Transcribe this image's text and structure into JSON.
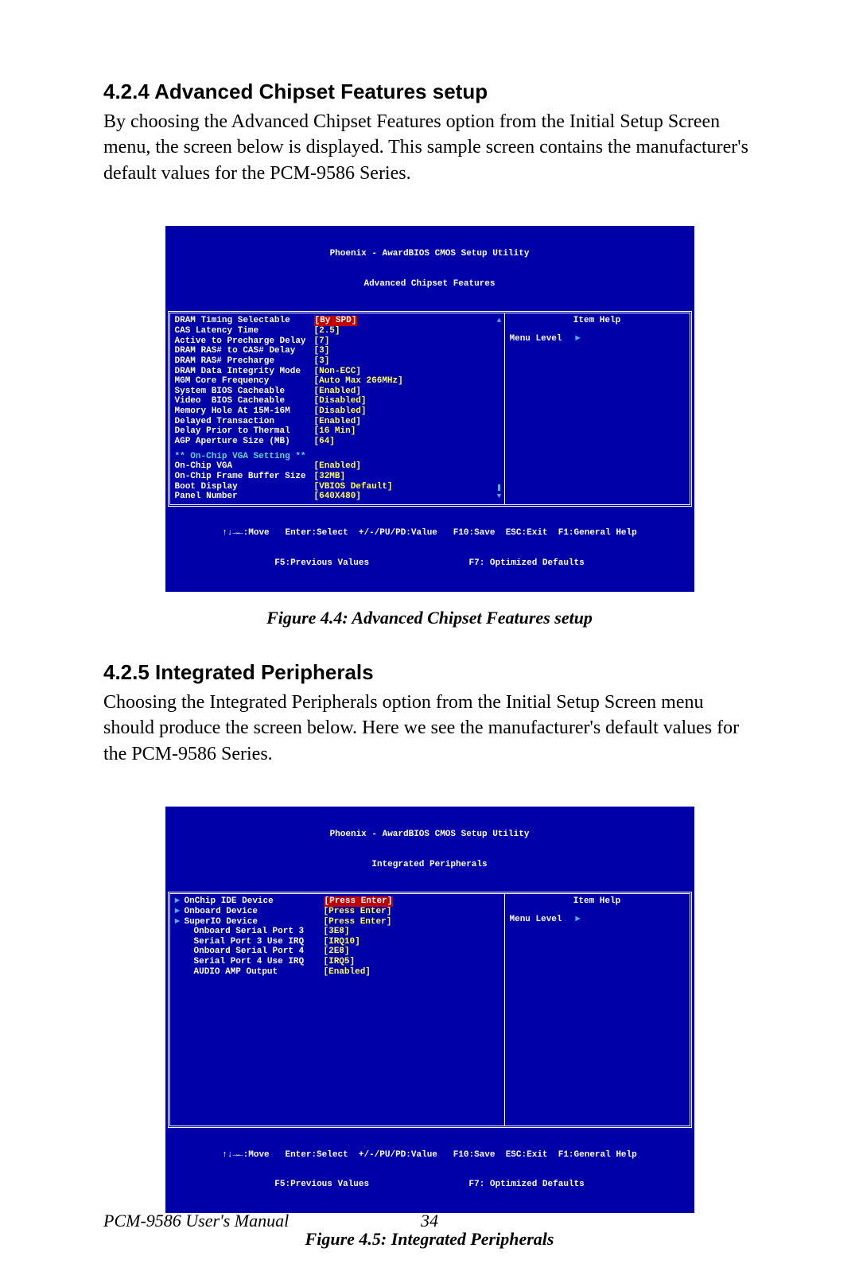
{
  "section1": {
    "heading": "4.2.4 Advanced Chipset Features setup",
    "body": "By choosing the Advanced Chipset Features option from the Initial Setup Screen menu, the screen below is displayed. This sample screen contains the manufacturer's default values for the PCM-9586 Series."
  },
  "figure1": {
    "bios_title1": "Phoenix - AwardBIOS CMOS Setup Utility",
    "bios_title2": "Advanced Chipset Features",
    "help_title": "Item Help",
    "menu_level": "Menu Level",
    "rows": [
      {
        "label": "DRAM Timing Selectable",
        "value": "[By SPD]",
        "selected": true
      },
      {
        "label": "CAS Latency Time",
        "value": "[2.5]"
      },
      {
        "label": "Active to Precharge Delay",
        "value": "[7]"
      },
      {
        "label": "DRAM RAS# to CAS# Delay",
        "value": "[3]"
      },
      {
        "label": "DRAM RAS# Precharge",
        "value": "[3]"
      },
      {
        "label": "DRAM Data Integrity Mode",
        "value": "[Non-ECC]"
      },
      {
        "label": "MGM Core Frequency",
        "value": "[Auto Max 266MHz]"
      },
      {
        "label": "System BIOS Cacheable",
        "value": "[Enabled]"
      },
      {
        "label": "Video  BIOS Cacheable",
        "value": "[Disabled]"
      },
      {
        "label": "Memory Hole At 15M-16M",
        "value": "[Disabled]"
      },
      {
        "label": "Delayed Transaction",
        "value": "[Enabled]"
      },
      {
        "label": "Delay Prior to Thermal",
        "value": "[16 Min]"
      },
      {
        "label": "AGP Aperture Size (MB)",
        "value": "[64]"
      }
    ],
    "vga_section": "** On-Chip VGA Setting **",
    "vga_rows": [
      {
        "label": "On-Chip VGA",
        "value": "[Enabled]"
      },
      {
        "label": "On-Chip Frame Buffer Size",
        "value": "[32MB]"
      },
      {
        "label": "Boot Display",
        "value": "[VBIOS Default]"
      },
      {
        "label": "Panel Number",
        "value": "[640X480]"
      }
    ],
    "footer1": "↑↓→←:Move   Enter:Select  +/-/PU/PD:Value   F10:Save  ESC:Exit  F1:General Help",
    "footer2": "F5:Previous Values                   F7: Optimized Defaults",
    "caption": "Figure 4.4: Advanced Chipset Features setup"
  },
  "section2": {
    "heading": "4.2.5 Integrated Peripherals",
    "body": "Choosing the Integrated Peripherals option from the Initial Setup Screen menu should produce the screen below.  Here we see the manufacturer's default values for the PCM-9586 Series."
  },
  "figure2": {
    "bios_title1": "Phoenix - AwardBIOS CMOS Setup Utility",
    "bios_title2": "Integrated Peripherals",
    "help_title": "Item Help",
    "menu_level": "Menu Level",
    "rows": [
      {
        "tri": true,
        "label": "OnChip IDE Device",
        "value": "[Press Enter]",
        "selected": true
      },
      {
        "tri": true,
        "label": "Onboard Device",
        "value": "[Press Enter]"
      },
      {
        "tri": true,
        "label": "SuperIO Device",
        "value": "[Press Enter]"
      },
      {
        "label": "Onboard Serial Port 3",
        "value": "[3E8]",
        "indent": true
      },
      {
        "label": "Serial Port 3 Use IRQ",
        "value": "[IRQ10]",
        "indent": true
      },
      {
        "label": "Onboard Serial Port 4",
        "value": "[2E8]",
        "indent": true
      },
      {
        "label": "Serial Port 4 Use IRQ",
        "value": "[IRQ5]",
        "indent": true
      },
      {
        "label": "AUDIO AMP Output",
        "value": "[Enabled]",
        "indent": true
      }
    ],
    "footer1": "↑↓→←:Move   Enter:Select  +/-/PU/PD:Value   F10:Save  ESC:Exit  F1:General Help",
    "footer2": "F5:Previous Values                   F7: Optimized Defaults",
    "caption": "Figure 4.5: Integrated Peripherals"
  },
  "footer": {
    "manual": "PCM-9586 User's Manual",
    "page": "34"
  }
}
